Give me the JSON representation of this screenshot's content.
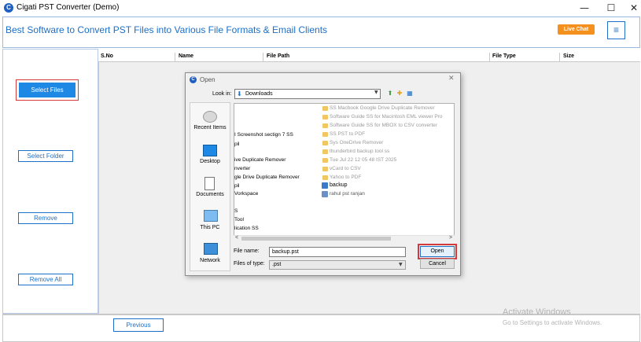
{
  "window": {
    "title": "Cigati PST Converter (Demo)",
    "minimize": "—",
    "maximize": "☐",
    "close": "✕"
  },
  "header": {
    "title": "Best Software to Convert PST Files into Various File Formats & Email Clients",
    "live_chat": "Live Chat",
    "menu": "≡"
  },
  "sidebar": {
    "select_files": "Select Files",
    "select_folder": "Select Folder",
    "remove": "Remove",
    "remove_all": "Remove All"
  },
  "table": {
    "columns": [
      "S.No",
      "Name",
      "File Path",
      "File Type",
      "Size"
    ]
  },
  "footer": {
    "previous": "Previous"
  },
  "watermark": {
    "line1": "Activate Windows",
    "line2": "Go to Settings to activate Windows."
  },
  "dialog": {
    "title": "Open",
    "look_in_label": "Look in:",
    "look_in_value": "Downloads",
    "places": [
      "Recent Items",
      "Desktop",
      "Documents",
      "This PC",
      "Network"
    ],
    "left_items": [
      "I Screenshot sectign 7 SS",
      "pil",
      "ive Duplicate Remover",
      "nverter",
      "gle Drive Duplicate Remover",
      "pil",
      "Vorkspace",
      "S",
      "Tool",
      "lication SS"
    ],
    "right_items": [
      "SS Macbook Google Drive Duplicate Remover",
      "Software Guide SS for Macintosh EML viewer Pro",
      "Software Guide SS for MBOX to CSV converter",
      "SS PST to PDF",
      "Sys OneDrive Remover",
      "thunderbird backup tool ss",
      "Tue Jul 22 12 05 48 IST 2025",
      "vCard to CSV",
      "Yahoo to PDF"
    ],
    "backup": "backup",
    "rahul": "rahul pst ranjan",
    "file_name_label": "File name:",
    "file_name_value": "backup.pst",
    "file_type_label": "Files of type:",
    "file_type_value": ".pst",
    "open": "Open",
    "cancel": "Cancel"
  }
}
